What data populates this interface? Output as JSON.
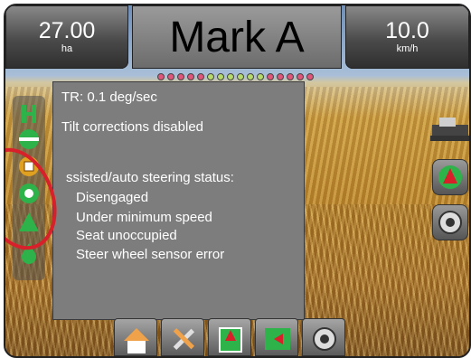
{
  "header": {
    "area_value": "27.00",
    "area_unit": "ha",
    "title": "Mark A",
    "speed_value": "10.0",
    "speed_unit": "km/h"
  },
  "lightbar": {
    "leds": [
      "#e0557a",
      "#e0557a",
      "#e0557a",
      "#e0557a",
      "#e0557a",
      "#b5d96a",
      "#b5d96a",
      "#b5d96a",
      "#b5d96a",
      "#b5d96a",
      "#b5d96a",
      "#e0557a",
      "#e0557a",
      "#e0557a",
      "#e0557a",
      "#e0557a"
    ]
  },
  "info_panel": {
    "turn_rate": "TR: 0.1 deg/sec",
    "tilt_status": "Tilt corrections disabled",
    "steering_heading": "ssisted/auto steering status:",
    "status_items": [
      "Disengaged",
      "Under minimum speed",
      "Seat unoccupied",
      "Steer wheel sensor error"
    ]
  },
  "left_bar": {
    "icons": [
      "steering-engage-icon",
      "tilt-icon",
      "auto-steer-icon",
      "wheel-icon",
      "lock-icon",
      "drop-icon"
    ]
  },
  "bottom_bar": {
    "buttons": [
      "home-icon",
      "tools-icon",
      "guidance-icon",
      "field-icon",
      "camera-icon"
    ]
  },
  "colors": {
    "accent_green": "#2db34a",
    "highlight_red": "#d8202a",
    "panel_gray": "#7d7d7d"
  }
}
